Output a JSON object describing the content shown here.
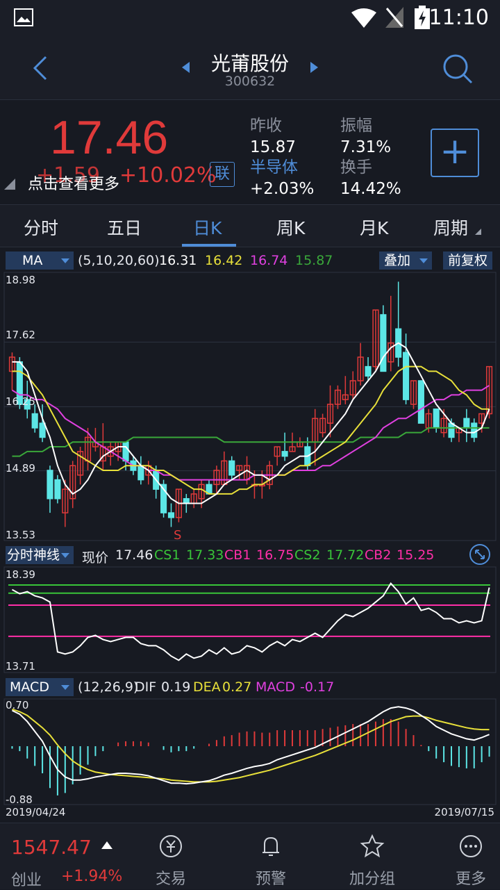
{
  "status": {
    "time": "11:10"
  },
  "header": {
    "title": "光莆股份",
    "code": "300632"
  },
  "quote": {
    "price": "17.46",
    "change": "+1.59",
    "change_pct": "+10.02%",
    "more": "点击查看更多",
    "link_btn": "联",
    "prev_close_label": "昨收",
    "prev_close": "15.87",
    "sector_label": "半导体",
    "sector_change": "+2.03%",
    "amplitude_label": "振幅",
    "amplitude": "7.31%",
    "turnover_label": "换手",
    "turnover": "14.42%"
  },
  "tabs": [
    "分时",
    "五日",
    "日K",
    "周K",
    "月K",
    "周期"
  ],
  "active_tab": "日K",
  "ma_bar": {
    "indicator": "MA",
    "params": "(5,10,20,60)",
    "ma5": "16.31",
    "ma10": "16.42",
    "ma20": "16.74",
    "ma60": "15.87",
    "overlay": "叠加",
    "adjust": "前复权"
  },
  "main_axis": {
    "top": "18.98",
    "l2": "17.62",
    "l3": "16.25",
    "l4": "14.89",
    "bottom": "13.53",
    "marker": "S"
  },
  "sub_bar": {
    "indicator": "分时神线",
    "price_label": "现价",
    "price": "17.46",
    "cs1_label": "CS1",
    "cs1": "17.33",
    "cb1_label": "CB1",
    "cb1": "16.75",
    "cs2_label": "CS2",
    "cs2": "17.72",
    "cb2_label": "CB2",
    "cb2": "15.25"
  },
  "sub_axis": {
    "top": "18.39",
    "bottom": "13.71"
  },
  "macd_bar": {
    "indicator": "MACD",
    "params": "(12,26,9)",
    "dif_label": "DIF",
    "dif": "0.19",
    "dea_label": "DEA",
    "dea": "0.27",
    "macd_label": "MACD",
    "macd": "-0.17"
  },
  "macd_axis": {
    "top": "0.70",
    "bottom": "-0.88"
  },
  "dates": {
    "start": "2019/04/24",
    "end": "2019/07/15"
  },
  "bottom_nav": {
    "index_value": "1547.47",
    "index_name": "创业",
    "index_change": "+1.94%",
    "items": [
      "交易",
      "预警",
      "加分组",
      "更多"
    ]
  },
  "colors": {
    "up": "#e03a3a",
    "down": "#5ce6e6",
    "accent": "#4f8dd8",
    "ma5": "#ffffff",
    "ma10": "#e8e03a",
    "ma20": "#e040e0",
    "ma60": "#3aa83a"
  },
  "chart_data": {
    "type": "candlestick",
    "y_range": [
      13.53,
      18.98
    ],
    "candles": [
      [
        17.0,
        17.3,
        16.6,
        17.4
      ],
      [
        17.2,
        16.3,
        16.2,
        17.3
      ],
      [
        16.4,
        16.2,
        16.0,
        16.8
      ],
      [
        16.1,
        15.8,
        15.7,
        16.3
      ],
      [
        15.9,
        15.6,
        15.5,
        16.3
      ],
      [
        14.9,
        14.3,
        14.0,
        15.0
      ],
      [
        14.7,
        14.3,
        14.2,
        14.8
      ],
      [
        14.0,
        14.5,
        13.7,
        14.7
      ],
      [
        14.3,
        15.0,
        14.1,
        15.1
      ],
      [
        14.8,
        15.3,
        14.6,
        15.4
      ],
      [
        15.1,
        15.6,
        14.9,
        15.8
      ],
      [
        15.4,
        15.5,
        15.3,
        15.8
      ],
      [
        15.1,
        15.4,
        14.9,
        15.9
      ],
      [
        15.2,
        15.4,
        15.0,
        15.5
      ],
      [
        15.3,
        15.5,
        15.1,
        15.5
      ],
      [
        15.5,
        15.1,
        14.9,
        15.5
      ],
      [
        15.1,
        14.9,
        14.8,
        15.2
      ],
      [
        15.0,
        14.7,
        14.6,
        15.2
      ],
      [
        14.8,
        15.0,
        14.6,
        15.1
      ],
      [
        14.9,
        14.5,
        14.3,
        15.0
      ],
      [
        14.6,
        14.0,
        13.9,
        14.7
      ],
      [
        14.0,
        13.9,
        13.7,
        14.2
      ],
      [
        13.9,
        14.5,
        13.8,
        14.5
      ],
      [
        14.3,
        14.2,
        14.0,
        14.4
      ],
      [
        14.2,
        14.4,
        14.1,
        14.5
      ],
      [
        14.3,
        14.6,
        14.1,
        14.7
      ],
      [
        14.6,
        14.4,
        14.4,
        14.7
      ],
      [
        14.6,
        14.9,
        14.4,
        15.0
      ],
      [
        14.6,
        15.1,
        14.6,
        15.3
      ],
      [
        15.1,
        14.8,
        14.7,
        15.2
      ],
      [
        14.9,
        15.0,
        14.7,
        15.0
      ],
      [
        14.7,
        15.0,
        14.6,
        15.2
      ],
      [
        14.6,
        14.6,
        14.3,
        14.9
      ],
      [
        14.6,
        14.6,
        14.3,
        14.9
      ],
      [
        14.6,
        15.0,
        14.5,
        15.1
      ],
      [
        15.2,
        15.4,
        15.0,
        15.4
      ],
      [
        15.3,
        15.2,
        15.1,
        15.7
      ],
      [
        15.3,
        15.4,
        15.3,
        15.7
      ],
      [
        15.4,
        15.5,
        15.4,
        15.6
      ],
      [
        15.4,
        15.0,
        14.9,
        15.6
      ],
      [
        15.5,
        16.0,
        15.0,
        16.2
      ],
      [
        15.7,
        16.0,
        15.6,
        16.1
      ],
      [
        15.9,
        16.3,
        15.6,
        16.7
      ],
      [
        16.3,
        16.6,
        16.2,
        16.7
      ],
      [
        16.4,
        16.5,
        16.3,
        16.9
      ],
      [
        16.5,
        16.8,
        16.4,
        17.0
      ],
      [
        16.8,
        17.3,
        16.7,
        17.6
      ],
      [
        17.1,
        16.9,
        16.8,
        17.3
      ],
      [
        17.1,
        18.3,
        17.0,
        18.3
      ],
      [
        18.2,
        17.0,
        17.0,
        18.4
      ],
      [
        17.2,
        17.6,
        17.0,
        18.6
      ],
      [
        17.9,
        17.3,
        17.1,
        18.9
      ],
      [
        17.4,
        16.4,
        16.3,
        17.8
      ],
      [
        16.3,
        16.8,
        16.2,
        16.8
      ],
      [
        16.8,
        15.9,
        15.9,
        16.8
      ],
      [
        15.8,
        16.1,
        15.7,
        16.2
      ],
      [
        16.2,
        15.8,
        15.7,
        16.2
      ],
      [
        15.7,
        16.0,
        15.6,
        16.2
      ],
      [
        15.9,
        15.6,
        15.5,
        16.0
      ],
      [
        15.7,
        15.8,
        15.5,
        15.8
      ],
      [
        16.0,
        15.8,
        15.5,
        16.2
      ],
      [
        15.9,
        15.6,
        15.5,
        16.0
      ],
      [
        15.9,
        16.1,
        15.7,
        16.1
      ],
      [
        16.1,
        17.1,
        16.0,
        17.1
      ]
    ],
    "ma5": [
      17.2,
      17.2,
      17.0,
      16.5,
      16.0,
      15.6,
      15.0,
      14.6,
      14.4,
      14.5,
      14.7,
      15.0,
      15.2,
      15.3,
      15.4,
      15.4,
      15.2,
      15.0,
      14.9,
      14.7,
      14.5,
      14.3,
      14.2,
      14.2,
      14.2,
      14.2,
      14.3,
      14.4,
      14.6,
      14.7,
      14.8,
      14.9,
      14.8,
      14.8,
      14.7,
      14.8,
      15.0,
      15.1,
      15.2,
      15.2,
      15.3,
      15.5,
      15.7,
      15.9,
      16.1,
      16.4,
      16.6,
      16.8,
      17.0,
      17.3,
      17.5,
      17.6,
      17.5,
      17.2,
      16.9,
      16.6,
      16.3,
      16.1,
      15.9,
      15.8,
      15.7,
      15.7,
      15.8,
      16.2
    ],
    "ma10": [
      17.0,
      17.0,
      16.9,
      16.7,
      16.5,
      16.2,
      15.9,
      15.6,
      15.3,
      15.2,
      15.1,
      15.0,
      14.9,
      14.9,
      14.9,
      15.0,
      15.0,
      15.0,
      15.0,
      14.9,
      14.9,
      14.8,
      14.7,
      14.6,
      14.5,
      14.5,
      14.4,
      14.4,
      14.4,
      14.4,
      14.5,
      14.5,
      14.6,
      14.6,
      14.7,
      14.8,
      14.8,
      14.9,
      15.0,
      15.0,
      15.1,
      15.2,
      15.3,
      15.4,
      15.5,
      15.7,
      15.9,
      16.1,
      16.3,
      16.6,
      16.8,
      17.0,
      17.1,
      17.1,
      17.1,
      17.0,
      17.0,
      16.9,
      16.8,
      16.6,
      16.5,
      16.3,
      16.2,
      16.2
    ],
    "ma20": [
      16.6,
      16.5,
      16.5,
      16.4,
      16.4,
      16.3,
      16.2,
      16.0,
      15.9,
      15.8,
      15.7,
      15.5,
      15.4,
      15.3,
      15.2,
      15.1,
      15.0,
      15.0,
      14.9,
      14.9,
      14.8,
      14.8,
      14.7,
      14.7,
      14.7,
      14.7,
      14.7,
      14.7,
      14.7,
      14.7,
      14.7,
      14.7,
      14.8,
      14.8,
      14.8,
      14.8,
      14.8,
      14.9,
      14.9,
      14.9,
      14.9,
      15.0,
      15.0,
      15.1,
      15.2,
      15.3,
      15.4,
      15.5,
      15.6,
      15.8,
      15.9,
      16.0,
      16.0,
      16.1,
      16.2,
      16.3,
      16.4,
      16.4,
      16.5,
      16.5,
      16.6,
      16.6,
      16.6,
      16.7
    ],
    "ma60": [
      15.2,
      15.2,
      15.3,
      15.3,
      15.3,
      15.4,
      15.4,
      15.4,
      15.5,
      15.5,
      15.5,
      15.5,
      15.5,
      15.5,
      15.5,
      15.5,
      15.6,
      15.6,
      15.6,
      15.6,
      15.6,
      15.6,
      15.6,
      15.6,
      15.6,
      15.6,
      15.6,
      15.6,
      15.5,
      15.5,
      15.5,
      15.5,
      15.5,
      15.5,
      15.5,
      15.5,
      15.5,
      15.5,
      15.5,
      15.5,
      15.5,
      15.5,
      15.5,
      15.5,
      15.5,
      15.5,
      15.6,
      15.6,
      15.6,
      15.6,
      15.6,
      15.6,
      15.7,
      15.7,
      15.7,
      15.8,
      15.8,
      15.8,
      15.8,
      15.8,
      15.8,
      15.8,
      15.8,
      15.8
    ],
    "sub_range": [
      13.71,
      18.39
    ],
    "sub_line": [
      17.5,
      17.3,
      17.4,
      17.2,
      17.1,
      16.9,
      14.5,
      14.4,
      14.5,
      14.8,
      15.2,
      15.3,
      15.1,
      15.0,
      15.1,
      15.2,
      15.2,
      14.9,
      14.8,
      14.8,
      14.6,
      14.3,
      14.1,
      14.4,
      14.2,
      14.3,
      14.6,
      14.4,
      14.7,
      14.4,
      14.5,
      14.8,
      14.7,
      14.5,
      14.8,
      15.0,
      14.8,
      15.1,
      15.0,
      15.2,
      15.4,
      15.2,
      15.6,
      16.0,
      16.3,
      16.2,
      16.4,
      16.6,
      16.9,
      17.2,
      17.8,
      17.4,
      16.8,
      17.1,
      16.5,
      16.6,
      16.4,
      16.1,
      16.1,
      15.9,
      16.0,
      15.9,
      16.0,
      17.6
    ],
    "sub_levels": [
      {
        "v": 17.72,
        "color": "#39c539"
      },
      {
        "v": 17.33,
        "color": "#39c539"
      },
      {
        "v": 16.75,
        "color": "#ff2fa8"
      },
      {
        "v": 15.25,
        "color": "#ff2fa8"
      }
    ],
    "macd_range": [
      -0.88,
      0.7
    ],
    "dif": [
      0.58,
      0.52,
      0.4,
      0.24,
      0.08,
      -0.16,
      -0.38,
      -0.5,
      -0.55,
      -0.55,
      -0.53,
      -0.5,
      -0.48,
      -0.46,
      -0.44,
      -0.44,
      -0.45,
      -0.46,
      -0.48,
      -0.52,
      -0.56,
      -0.6,
      -0.6,
      -0.61,
      -0.6,
      -0.58,
      -0.56,
      -0.52,
      -0.47,
      -0.44,
      -0.4,
      -0.36,
      -0.33,
      -0.31,
      -0.28,
      -0.22,
      -0.18,
      -0.14,
      -0.1,
      -0.06,
      -0.02,
      0.04,
      0.1,
      0.16,
      0.22,
      0.28,
      0.34,
      0.4,
      0.48,
      0.56,
      0.62,
      0.64,
      0.62,
      0.58,
      0.5,
      0.42,
      0.32,
      0.26,
      0.2,
      0.16,
      0.12,
      0.1,
      0.14,
      0.19
    ],
    "dea": [
      0.6,
      0.56,
      0.5,
      0.4,
      0.3,
      0.18,
      0.02,
      -0.12,
      -0.24,
      -0.32,
      -0.38,
      -0.42,
      -0.44,
      -0.46,
      -0.47,
      -0.48,
      -0.49,
      -0.5,
      -0.51,
      -0.52,
      -0.53,
      -0.55,
      -0.56,
      -0.57,
      -0.58,
      -0.58,
      -0.58,
      -0.57,
      -0.55,
      -0.53,
      -0.51,
      -0.48,
      -0.45,
      -0.42,
      -0.39,
      -0.35,
      -0.31,
      -0.27,
      -0.23,
      -0.19,
      -0.15,
      -0.1,
      -0.05,
      0.0,
      0.05,
      0.1,
      0.16,
      0.22,
      0.28,
      0.34,
      0.4,
      0.44,
      0.48,
      0.49,
      0.49,
      0.46,
      0.42,
      0.39,
      0.36,
      0.33,
      0.3,
      0.28,
      0.27,
      0.27
    ],
    "macd_hist": [
      -0.04,
      -0.08,
      -0.2,
      -0.32,
      -0.44,
      -0.68,
      -0.8,
      -0.76,
      -0.62,
      -0.46,
      -0.3,
      -0.16,
      -0.08,
      0.0,
      0.06,
      0.08,
      0.08,
      0.08,
      0.06,
      0.0,
      -0.06,
      -0.1,
      -0.08,
      -0.08,
      -0.04,
      0.0,
      0.04,
      0.1,
      0.16,
      0.18,
      0.22,
      0.24,
      0.24,
      0.22,
      0.22,
      0.26,
      0.26,
      0.26,
      0.26,
      0.26,
      0.26,
      0.28,
      0.3,
      0.32,
      0.34,
      0.36,
      0.36,
      0.36,
      0.4,
      0.44,
      0.44,
      0.4,
      0.28,
      0.18,
      0.02,
      -0.08,
      -0.2,
      -0.26,
      -0.32,
      -0.34,
      -0.36,
      -0.36,
      -0.26,
      -0.17
    ]
  }
}
